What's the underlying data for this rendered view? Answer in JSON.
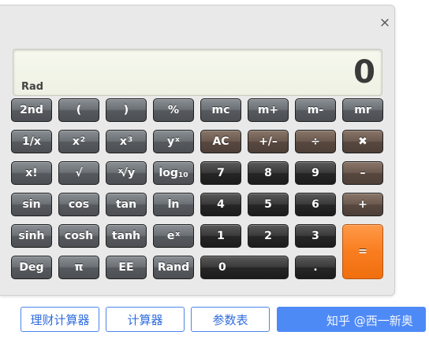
{
  "window": {
    "close_glyph": "×"
  },
  "display": {
    "value": "0",
    "angle_mode": "Rad"
  },
  "keys": {
    "second": "2nd",
    "lparen": "(",
    "rparen": ")",
    "percent": "%",
    "mc": "mc",
    "mplus": "m+",
    "mminus": "m-",
    "mr": "mr",
    "recip": "1/x",
    "sq": "x",
    "sq_exp": "2",
    "cube": "x",
    "cube_exp": "3",
    "pow": "y",
    "pow_exp": "x",
    "ac": "AC",
    "sign": "+/–",
    "divide": "÷",
    "multiply": "✖",
    "fact": "x!",
    "sqrt": "√",
    "root_idx": "x",
    "root": "√y",
    "log": "log",
    "log_sub": "10",
    "n7": "7",
    "n8": "8",
    "n9": "9",
    "minus": "–",
    "sin": "sin",
    "cos": "cos",
    "tan": "tan",
    "ln": "ln",
    "n4": "4",
    "n5": "5",
    "n6": "6",
    "plus": "+",
    "sinh": "sinh",
    "cosh": "cosh",
    "tanh": "tanh",
    "exp": "e",
    "exp_exp": "x",
    "n1": "1",
    "n2": "2",
    "n3": "3",
    "deg": "Deg",
    "pi": "π",
    "ee": "EE",
    "rand": "Rand",
    "n0": "0",
    "dot": ".",
    "equals": "="
  },
  "bottom_tabs": [
    "理财计算器",
    "计算器",
    "参数表"
  ],
  "watermark": "知乎 @西一新奥",
  "colors": {
    "accent": "#4e8af6",
    "equals_key": "#f97d1f"
  }
}
